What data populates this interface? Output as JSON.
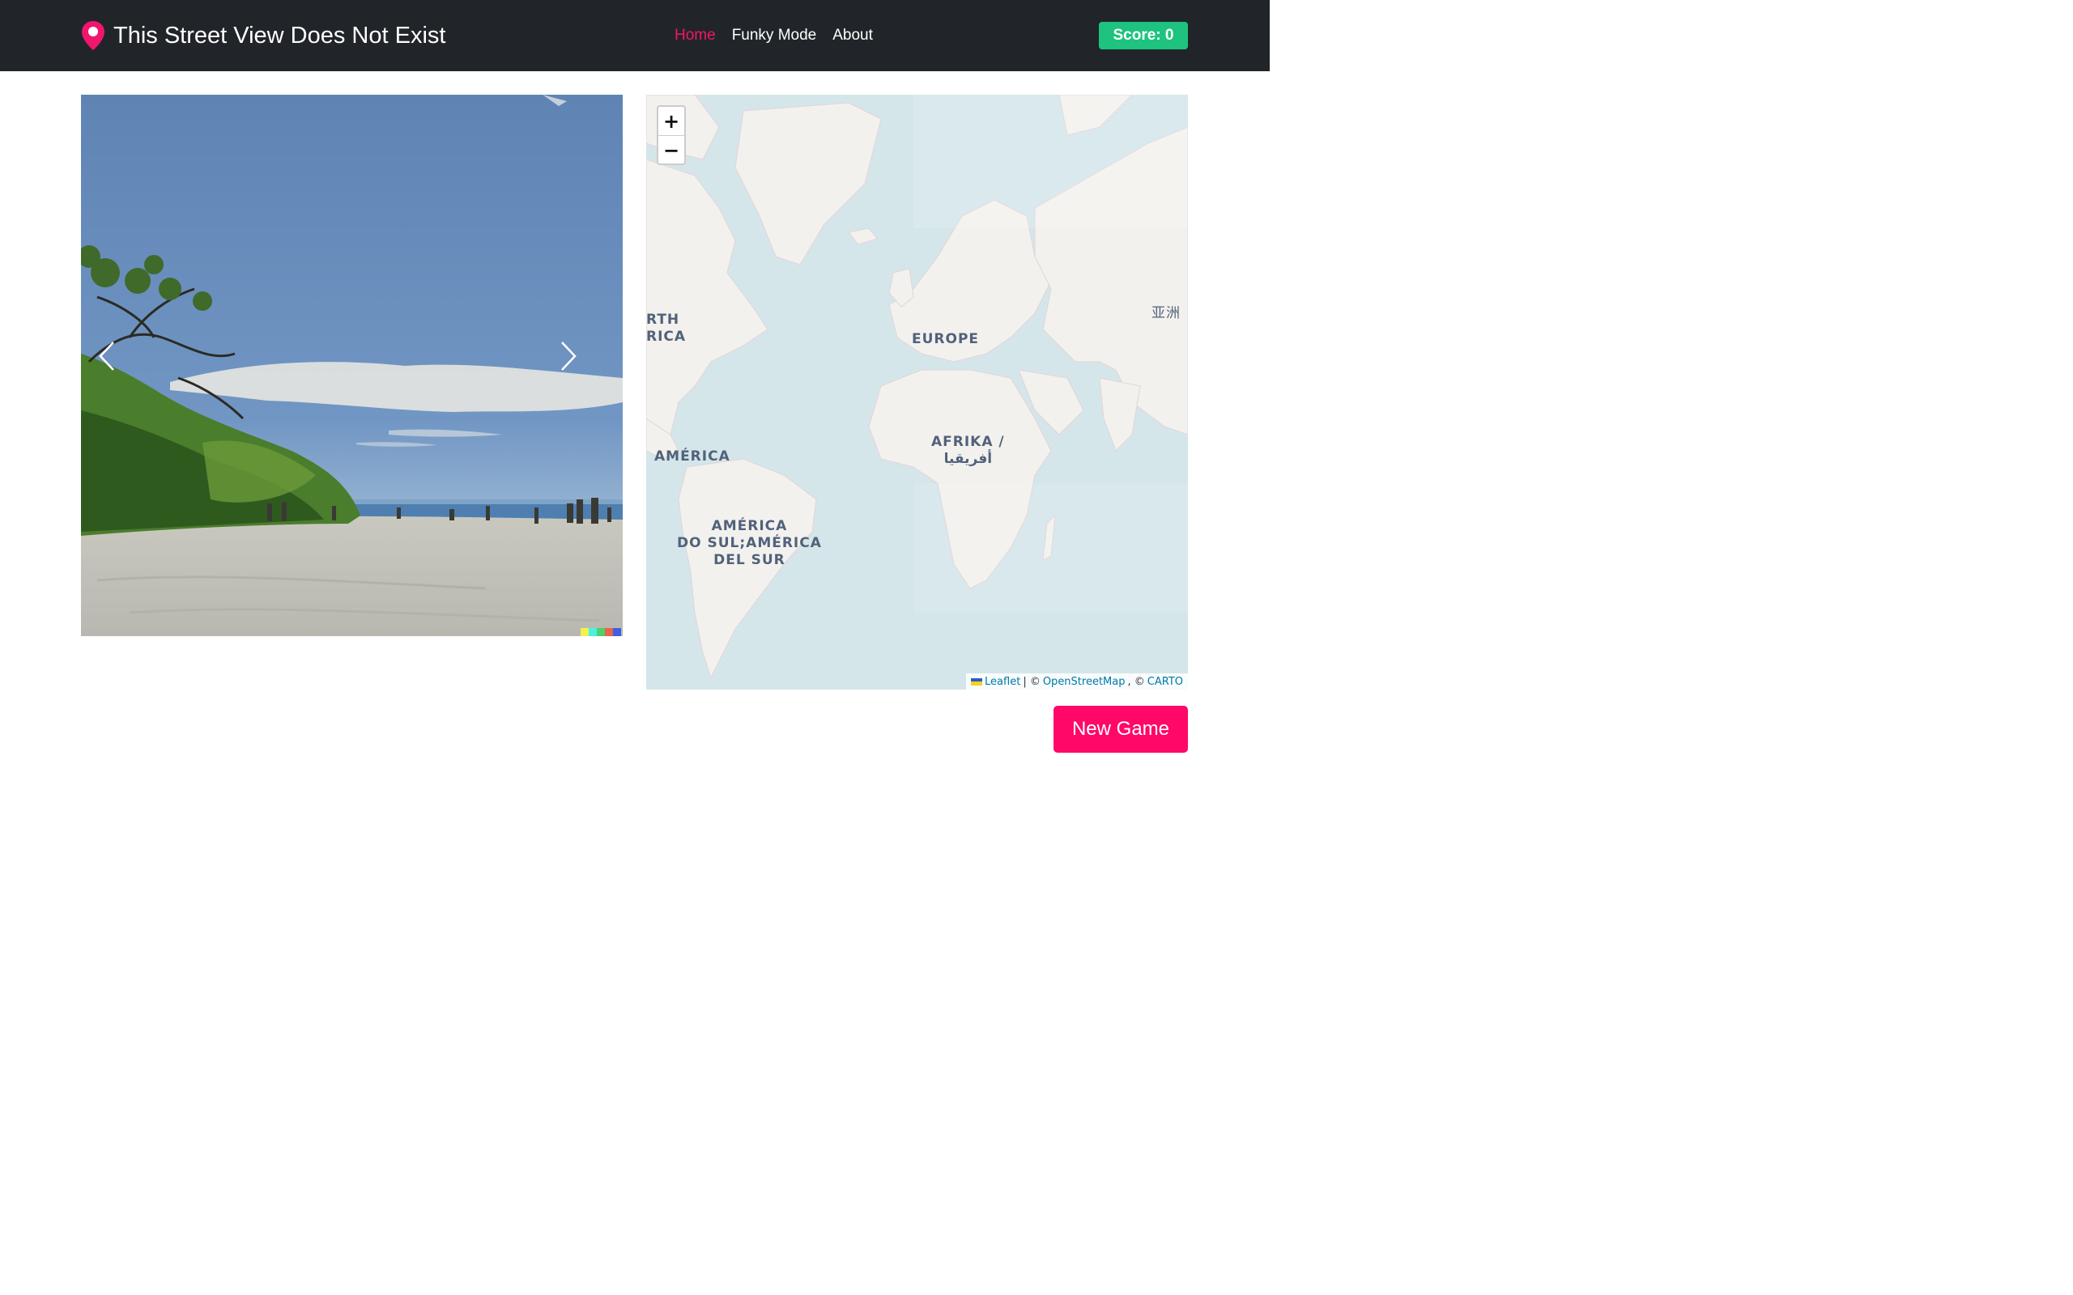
{
  "navbar": {
    "brand_icon": "map-pin-icon",
    "brand_title": "This Street View Does Not Exist",
    "links": [
      {
        "label": "Home",
        "active": true
      },
      {
        "label": "Funky Mode",
        "active": false
      },
      {
        "label": "About",
        "active": false
      }
    ],
    "score_label": "Score: 0"
  },
  "viewer": {
    "prev_icon": "chevron-left-icon",
    "next_icon": "chevron-right-icon",
    "indicator_colors": [
      "#f4f04e",
      "#4af0e0",
      "#4fd06a",
      "#e8644a",
      "#3f5fe0"
    ]
  },
  "map": {
    "zoom_in": "+",
    "zoom_out": "−",
    "labels": {
      "north_america": "RTH\nRICA",
      "europe": "EUROPE",
      "asia": "亚洲",
      "africa": "AFRIKA /\nأفريقيا",
      "central_america": "AMÉRICA",
      "south_america": "AMÉRICA\nDO SUL;AMÉRICA\nDEL SUR"
    },
    "attribution": {
      "leaflet": "Leaflet",
      "separator": "| ©",
      "osm": "OpenStreetMap",
      "comma": ", ©",
      "carto": "CARTO"
    }
  },
  "actions": {
    "new_game_label": "New Game"
  },
  "colors": {
    "navbar_bg": "#212529",
    "accent": "#f0166d",
    "score_bg": "#1dc37e",
    "new_game_bg": "#ff0867"
  }
}
